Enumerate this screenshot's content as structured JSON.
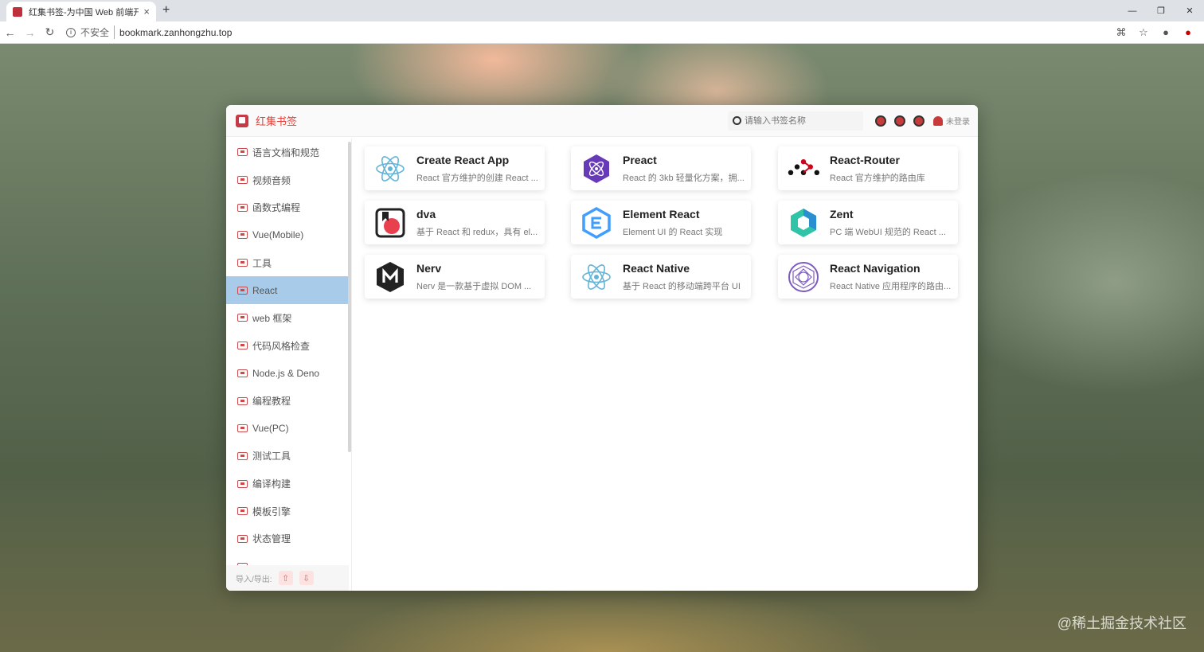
{
  "browser": {
    "tab_title": "红集书签-为中国 Web 前端开发",
    "tab_close": "×",
    "new_tab": "+",
    "insecure_label": "不安全",
    "url": "bookmark.zanhongzhu.top",
    "window_minimize": "—",
    "window_restore": "❐",
    "window_close": "✕"
  },
  "app": {
    "brand": "红集书签",
    "search_placeholder": "请输入书签名称",
    "login_label": "未登录",
    "import_export_label": "导入/导出:"
  },
  "sidebar": {
    "items": [
      {
        "label": "语言文档和规范"
      },
      {
        "label": "视频音频"
      },
      {
        "label": "函数式编程"
      },
      {
        "label": "Vue(Mobile)"
      },
      {
        "label": "工具"
      },
      {
        "label": "React",
        "active": true
      },
      {
        "label": "web 框架"
      },
      {
        "label": "代码风格检查"
      },
      {
        "label": "Node.js & Deno"
      },
      {
        "label": "编程教程"
      },
      {
        "label": "Vue(PC)"
      },
      {
        "label": "测试工具"
      },
      {
        "label": "编译构建"
      },
      {
        "label": "模板引擎"
      },
      {
        "label": "状态管理"
      },
      {
        "label": "... "
      }
    ]
  },
  "cards": [
    {
      "title": "Create React App",
      "desc": "React 官方维护的创建 React ...",
      "icon": "react-atom-icon",
      "color": "#61b4d8"
    },
    {
      "title": "Preact",
      "desc": "React 的 3kb 轻量化方案，拥...",
      "icon": "preact-icon",
      "color": "#673ab8"
    },
    {
      "title": "React-Router",
      "desc": "React 官方维护的路由库",
      "icon": "react-router-icon",
      "color": "#d0021b"
    },
    {
      "title": "dva",
      "desc": "基于 React 和 redux，具有 el...",
      "icon": "dva-icon",
      "color": "#e8404f"
    },
    {
      "title": "Element React",
      "desc": "Element UI 的 React 实现",
      "icon": "element-icon",
      "color": "#409eff"
    },
    {
      "title": "Zent",
      "desc": "PC 端 WebUI 规范的 React ...",
      "icon": "zent-icon",
      "color": "#2fc3a7"
    },
    {
      "title": "Nerv",
      "desc": "Nerv 是一款基于虚拟 DOM ...",
      "icon": "nerv-icon",
      "color": "#222222"
    },
    {
      "title": "React Native",
      "desc": "基于 React 的移动端跨平台 UI",
      "icon": "react-native-icon",
      "color": "#61b4d8"
    },
    {
      "title": "React Navigation",
      "desc": "React Native 应用程序的路由...",
      "icon": "react-navigation-icon",
      "color": "#7d5bbf"
    }
  ],
  "watermark": "@稀土掘金技术社区"
}
